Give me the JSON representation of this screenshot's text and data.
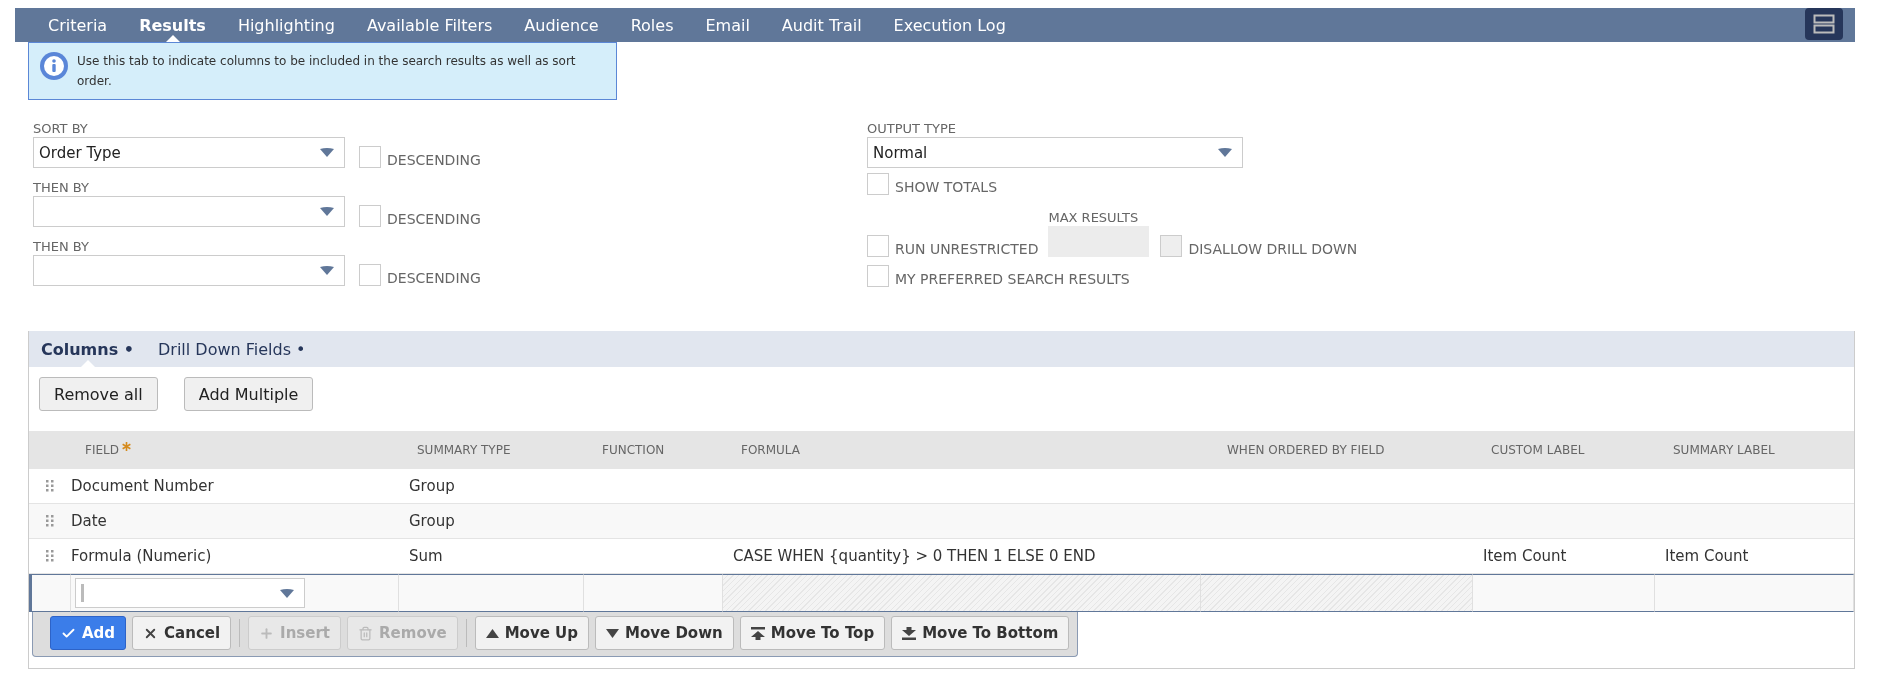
{
  "tabs": [
    {
      "label": "Criteria",
      "selected": false
    },
    {
      "label": "Results",
      "selected": true
    },
    {
      "label": "Highlighting",
      "selected": false
    },
    {
      "label": "Available Filters",
      "selected": false
    },
    {
      "label": "Audience",
      "selected": false
    },
    {
      "label": "Roles",
      "selected": false
    },
    {
      "label": "Email",
      "selected": false
    },
    {
      "label": "Audit Trail",
      "selected": false
    },
    {
      "label": "Execution Log",
      "selected": false
    }
  ],
  "info_message": "Use this tab to indicate columns to be included in the search results as well as sort order.",
  "sort_fields": [
    {
      "label": "SORT BY",
      "value": "Order Type",
      "descending_label": "DESCENDING",
      "descending": false
    },
    {
      "label": "THEN BY",
      "descending_label": "DESCENDING",
      "descending": false
    },
    {
      "label": "THEN BY",
      "descending_label": "DESCENDING",
      "descending": false
    }
  ],
  "output_type": {
    "label": "OUTPUT TYPE",
    "value": "Normal"
  },
  "show_totals": {
    "label": "SHOW TOTALS",
    "checked": false
  },
  "run_unrestricted": {
    "label": "RUN UNRESTRICTED",
    "checked": false
  },
  "max_results": {
    "label": "MAX RESULTS",
    "disabled": true
  },
  "disallow_drill_down": {
    "label": "DISALLOW DRILL DOWN",
    "checked": false,
    "disabled": true
  },
  "my_preferred": {
    "label": "MY PREFERRED SEARCH RESULTS",
    "checked": false
  },
  "subtabs": [
    {
      "label": "Columns •",
      "selected": true
    },
    {
      "label": "Drill Down Fields •",
      "selected": false
    }
  ],
  "list_actions": [
    "Remove all",
    "Add Multiple"
  ],
  "table": {
    "columns": [
      {
        "label": "FIELD",
        "required": true
      },
      {
        "label": "SUMMARY TYPE",
        "required": false
      },
      {
        "label": "FUNCTION",
        "required": false
      },
      {
        "label": "FORMULA",
        "required": false
      },
      {
        "label": "WHEN ORDERED BY FIELD",
        "required": false
      },
      {
        "label": "CUSTOM LABEL",
        "required": false
      },
      {
        "label": "SUMMARY LABEL",
        "required": false
      }
    ],
    "rows": [
      {
        "cells": [
          "Document Number",
          "Group",
          "",
          "",
          "",
          "",
          ""
        ]
      },
      {
        "cells": [
          "Date",
          "Group",
          "",
          "",
          "",
          "",
          ""
        ]
      },
      {
        "cells": [
          "Formula (Numeric)",
          "Sum",
          "",
          "CASE WHEN {quantity} > 0 THEN 1 ELSE 0 END",
          "",
          "Item Count",
          "Item Count"
        ]
      }
    ],
    "edit_row": [
      {
        "kind": "select"
      },
      {
        "kind": "blank"
      },
      {
        "kind": "blank"
      },
      {
        "kind": "locked"
      },
      {
        "kind": "locked"
      },
      {
        "kind": "blank"
      },
      {
        "kind": "blank"
      }
    ]
  },
  "row_buttons": [
    {
      "label": "Add",
      "primary": true,
      "disabled": false
    },
    {
      "label": "Cancel",
      "primary": false,
      "disabled": false
    },
    {
      "label": "Insert",
      "primary": false,
      "disabled": true
    },
    {
      "label": "Remove",
      "primary": false,
      "disabled": true
    },
    {
      "label": "Move Up",
      "primary": false,
      "disabled": false
    },
    {
      "label": "Move Down",
      "primary": false,
      "disabled": false
    },
    {
      "label": "Move To Top",
      "primary": false,
      "disabled": false
    },
    {
      "label": "Move To Bottom",
      "primary": false,
      "disabled": false
    }
  ]
}
